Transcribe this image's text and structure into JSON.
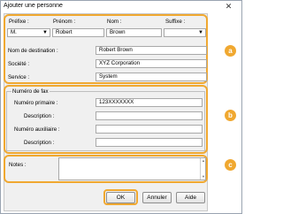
{
  "window": {
    "title": "Ajouter une personne",
    "close_glyph": "✕"
  },
  "name_section": {
    "prefix": {
      "label": "Préfixe :",
      "value": "M."
    },
    "first_name": {
      "label": "Prénom :",
      "value": "Robert"
    },
    "last_name": {
      "label": "Nom :",
      "value": "Brown"
    },
    "suffix": {
      "label": "Suffixe :",
      "value": ""
    },
    "display_name": {
      "label": "Nom de destination :",
      "value": "Robert Brown"
    },
    "company": {
      "label": "Société :",
      "value": "XYZ Corporation"
    },
    "department": {
      "label": "Service :",
      "value": "System"
    }
  },
  "fax_section": {
    "heading": "Numéro de fax",
    "primary": {
      "label": "Numéro primaire :",
      "value": "123XXXXXXX"
    },
    "primary_desc": {
      "label": "Description :",
      "value": ""
    },
    "secondary": {
      "label": "Numéro auxiliaire :",
      "value": ""
    },
    "secondary_desc": {
      "label": "Description :",
      "value": ""
    }
  },
  "notes": {
    "label": "Notes :",
    "value": ""
  },
  "buttons": {
    "ok": "OK",
    "cancel": "Annuler",
    "help": "Aide"
  },
  "markers": {
    "a": "a",
    "b": "b",
    "c": "c"
  },
  "colors": {
    "highlight": "#f0a830"
  }
}
